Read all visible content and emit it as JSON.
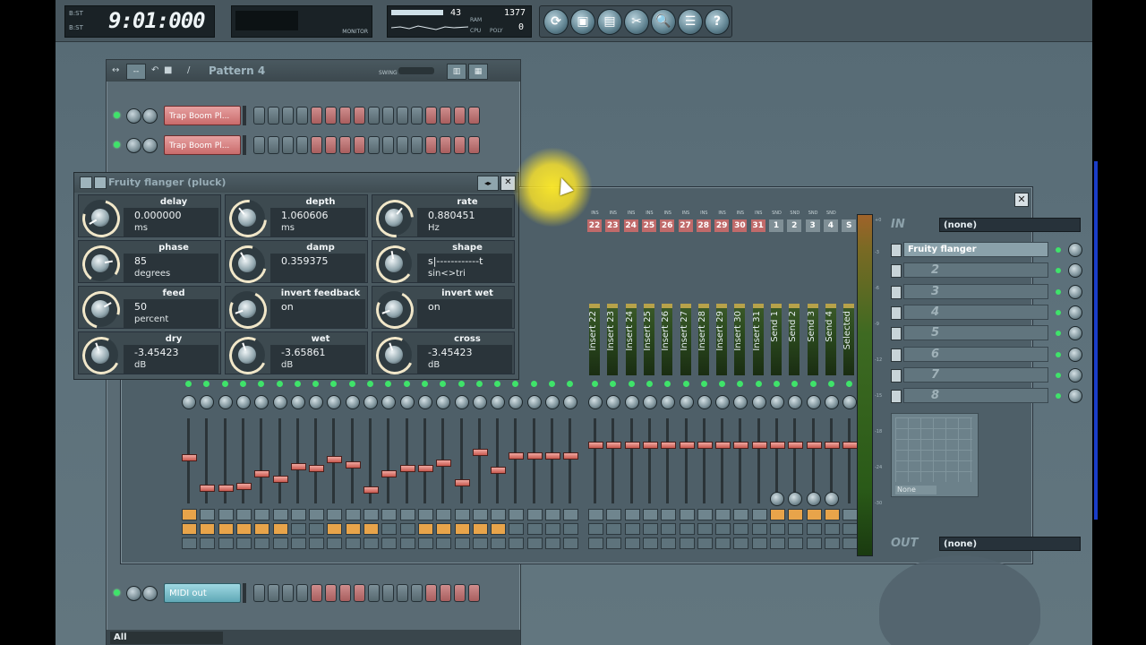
{
  "toolbar": {
    "time": "9:01:000",
    "time_prefix_top": "B:ST",
    "time_prefix_bottom": "B:ST",
    "monitor_label": "MONITOR",
    "cpu_value": "43",
    "ram_value": "1377",
    "ram_label": "RAM",
    "cpu_label": "CPU",
    "poly_label": "POLY",
    "poly_value": "0",
    "icons": [
      "refresh-icon",
      "save-icon",
      "render-icon",
      "cut-icon",
      "plugin-search-icon",
      "notes-icon",
      "help-icon"
    ],
    "icon_glyphs": [
      "⟳",
      "▣",
      "▤",
      "✂",
      "🔍",
      "☰",
      "?"
    ]
  },
  "sequencer": {
    "pattern": "Pattern 4",
    "swing_label": "SWING",
    "channels": [
      {
        "label": "Trap Boom Pl...",
        "color": "#c96b6b"
      },
      {
        "label": "Trap Boom Pl...",
        "color": "#c96b6b"
      },
      {
        "label": "MIDI out",
        "color": "#5fa8b6"
      }
    ],
    "filter": "All"
  },
  "flanger": {
    "title": "Fruity flanger (pluck)",
    "nav": "◂▸",
    "close": "✕",
    "params": [
      {
        "name": "delay",
        "value": "0.000000",
        "unit": "ms"
      },
      {
        "name": "depth",
        "value": "1.060606",
        "unit": "ms"
      },
      {
        "name": "rate",
        "value": "0.880451",
        "unit": "Hz"
      },
      {
        "name": "phase",
        "value": "85",
        "unit": "degrees"
      },
      {
        "name": "damp",
        "value": "0.359375",
        "unit": ""
      },
      {
        "name": "shape",
        "value": "s|------------t",
        "unit": "sin<>tri"
      },
      {
        "name": "feed",
        "value": "50",
        "unit": "percent"
      },
      {
        "name": "invert feedback",
        "value": "on",
        "unit": ""
      },
      {
        "name": "invert wet",
        "value": "on",
        "unit": ""
      },
      {
        "name": "dry",
        "value": "-3.45423",
        "unit": "dB"
      },
      {
        "name": "wet",
        "value": "-3.65861",
        "unit": "dB"
      },
      {
        "name": "cross",
        "value": "-3.45423",
        "unit": "dB"
      }
    ]
  },
  "mixer": {
    "close": "✕",
    "strips": [
      {
        "tag": "INS",
        "num": "22",
        "name": "Insert 22"
      },
      {
        "tag": "INS",
        "num": "23",
        "name": "Insert 23"
      },
      {
        "tag": "INS",
        "num": "24",
        "name": "Insert 24"
      },
      {
        "tag": "INS",
        "num": "25",
        "name": "Insert 25"
      },
      {
        "tag": "INS",
        "num": "26",
        "name": "Insert 26"
      },
      {
        "tag": "INS",
        "num": "27",
        "name": "Insert 27"
      },
      {
        "tag": "INS",
        "num": "28",
        "name": "Insert 28"
      },
      {
        "tag": "INS",
        "num": "29",
        "name": "Insert 29"
      },
      {
        "tag": "INS",
        "num": "30",
        "name": "Insert 30"
      },
      {
        "tag": "INS",
        "num": "31",
        "name": "Insert 31"
      },
      {
        "tag": "SND",
        "num": "1",
        "name": "Send 1"
      },
      {
        "tag": "SND",
        "num": "2",
        "name": "Send 2"
      },
      {
        "tag": "SND",
        "num": "3",
        "name": "Send 3"
      },
      {
        "tag": "SND",
        "num": "4",
        "name": "Send 4"
      },
      {
        "tag": "",
        "num": "S",
        "name": "Selected"
      }
    ],
    "in_label": "IN",
    "in_value": "(none)",
    "out_label": "OUT",
    "out_value": "(none)",
    "slots": [
      {
        "label": "Fruity flanger",
        "active": true
      },
      {
        "label": "2",
        "active": false
      },
      {
        "label": "3",
        "active": false
      },
      {
        "label": "4",
        "active": false
      },
      {
        "label": "5",
        "active": false
      },
      {
        "label": "6",
        "active": false
      },
      {
        "label": "7",
        "active": false
      },
      {
        "label": "8",
        "active": false
      }
    ],
    "eq_preset": "None"
  }
}
